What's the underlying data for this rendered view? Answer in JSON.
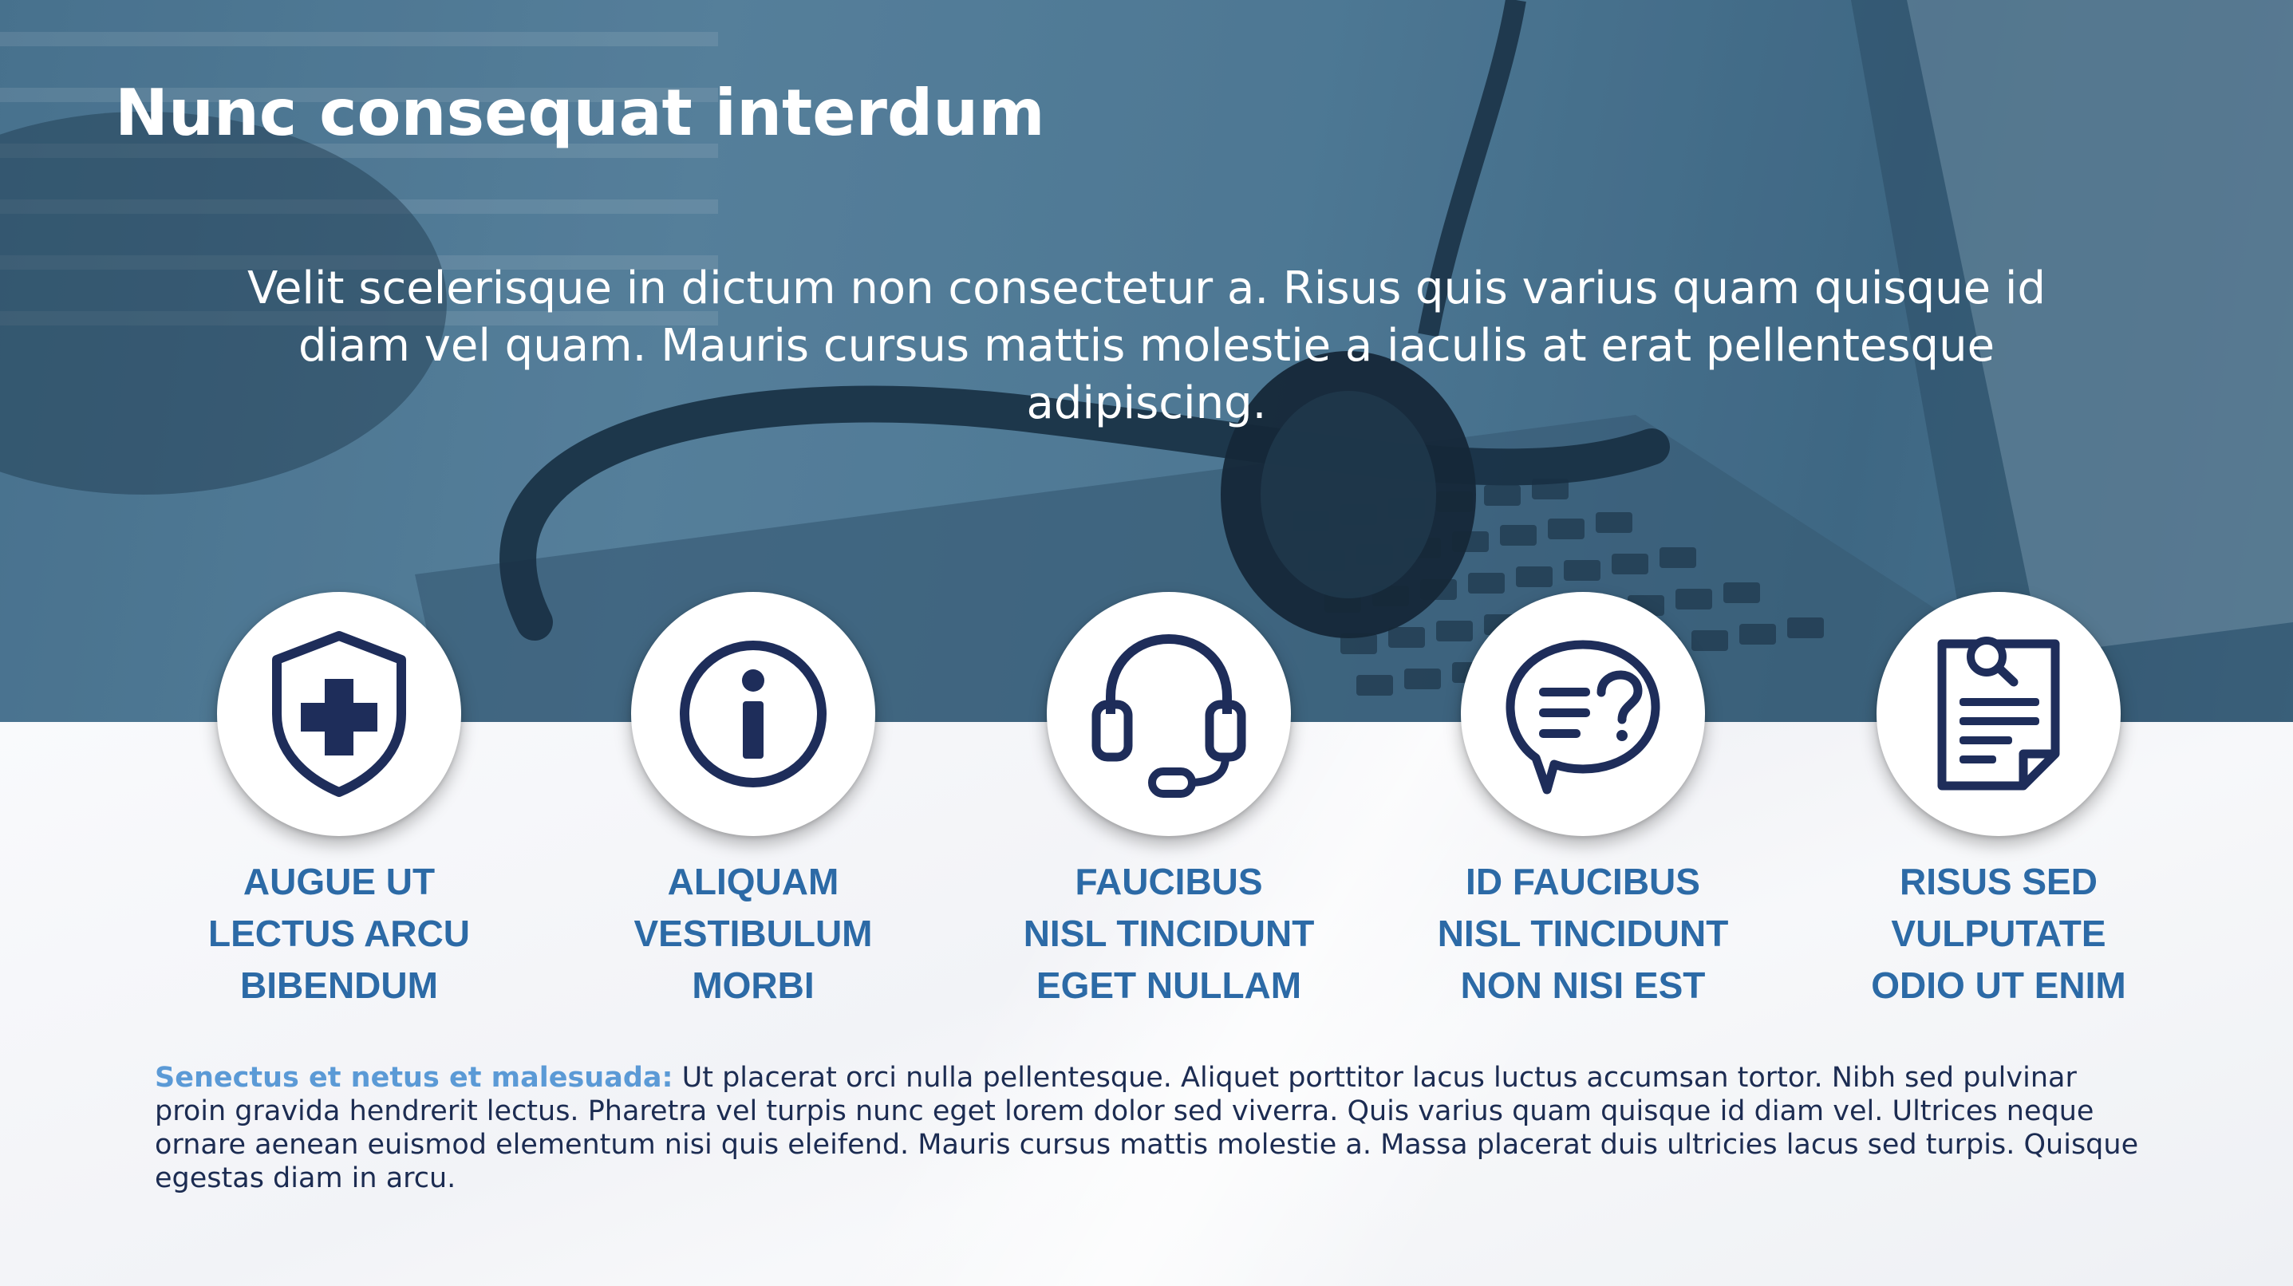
{
  "slide": {
    "title": "Nunc consequat interdum",
    "intro": "Velit scelerisque in dictum non consectetur a. Risus quis varius quam quisque id diam vel quam. Mauris cursus mattis molestie a iaculis at erat pellentesque adipiscing.",
    "features": [
      {
        "icon": "shield-plus-icon",
        "lines": [
          "AUGUE UT",
          "LECTUS ARCU",
          "BIBENDUM"
        ]
      },
      {
        "icon": "info-icon",
        "lines": [
          "ALIQUAM",
          "VESTIBULUM",
          "MORBI"
        ]
      },
      {
        "icon": "headset-icon",
        "lines": [
          "FAUCIBUS",
          "NISL TINCIDUNT",
          "EGET NULLAM"
        ]
      },
      {
        "icon": "chat-question-icon",
        "lines": [
          "ID FAUCIBUS",
          "NISL TINCIDUNT",
          "NON NISI EST"
        ]
      },
      {
        "icon": "document-search-icon",
        "lines": [
          "RISUS SED",
          "VULPUTATE",
          "ODIO UT ENIM"
        ]
      }
    ],
    "body": {
      "lead": "Senectus et netus et malesuada:",
      "text": " Ut placerat orci nulla pellentesque. Aliquet porttitor lacus luctus accumsan tortor. Nibh sed pulvinar proin gravida hendrerit lectus. Pharetra vel turpis nunc eget lorem dolor sed viverra. Quis varius quam quisque id diam vel. Ultrices neque ornare aenean euismod elementum nisi quis eleifend. Mauris cursus mattis molestie a. Massa placerat duis ultricies lacus sed turpis. Quisque egestas diam in arcu."
    }
  },
  "colors": {
    "hero_blue": "#527c97",
    "icon_navy": "#1e2d5a",
    "label_blue": "#2c6aa6",
    "lead_blue": "#5b9ad6",
    "body_navy": "#1c2c52"
  }
}
